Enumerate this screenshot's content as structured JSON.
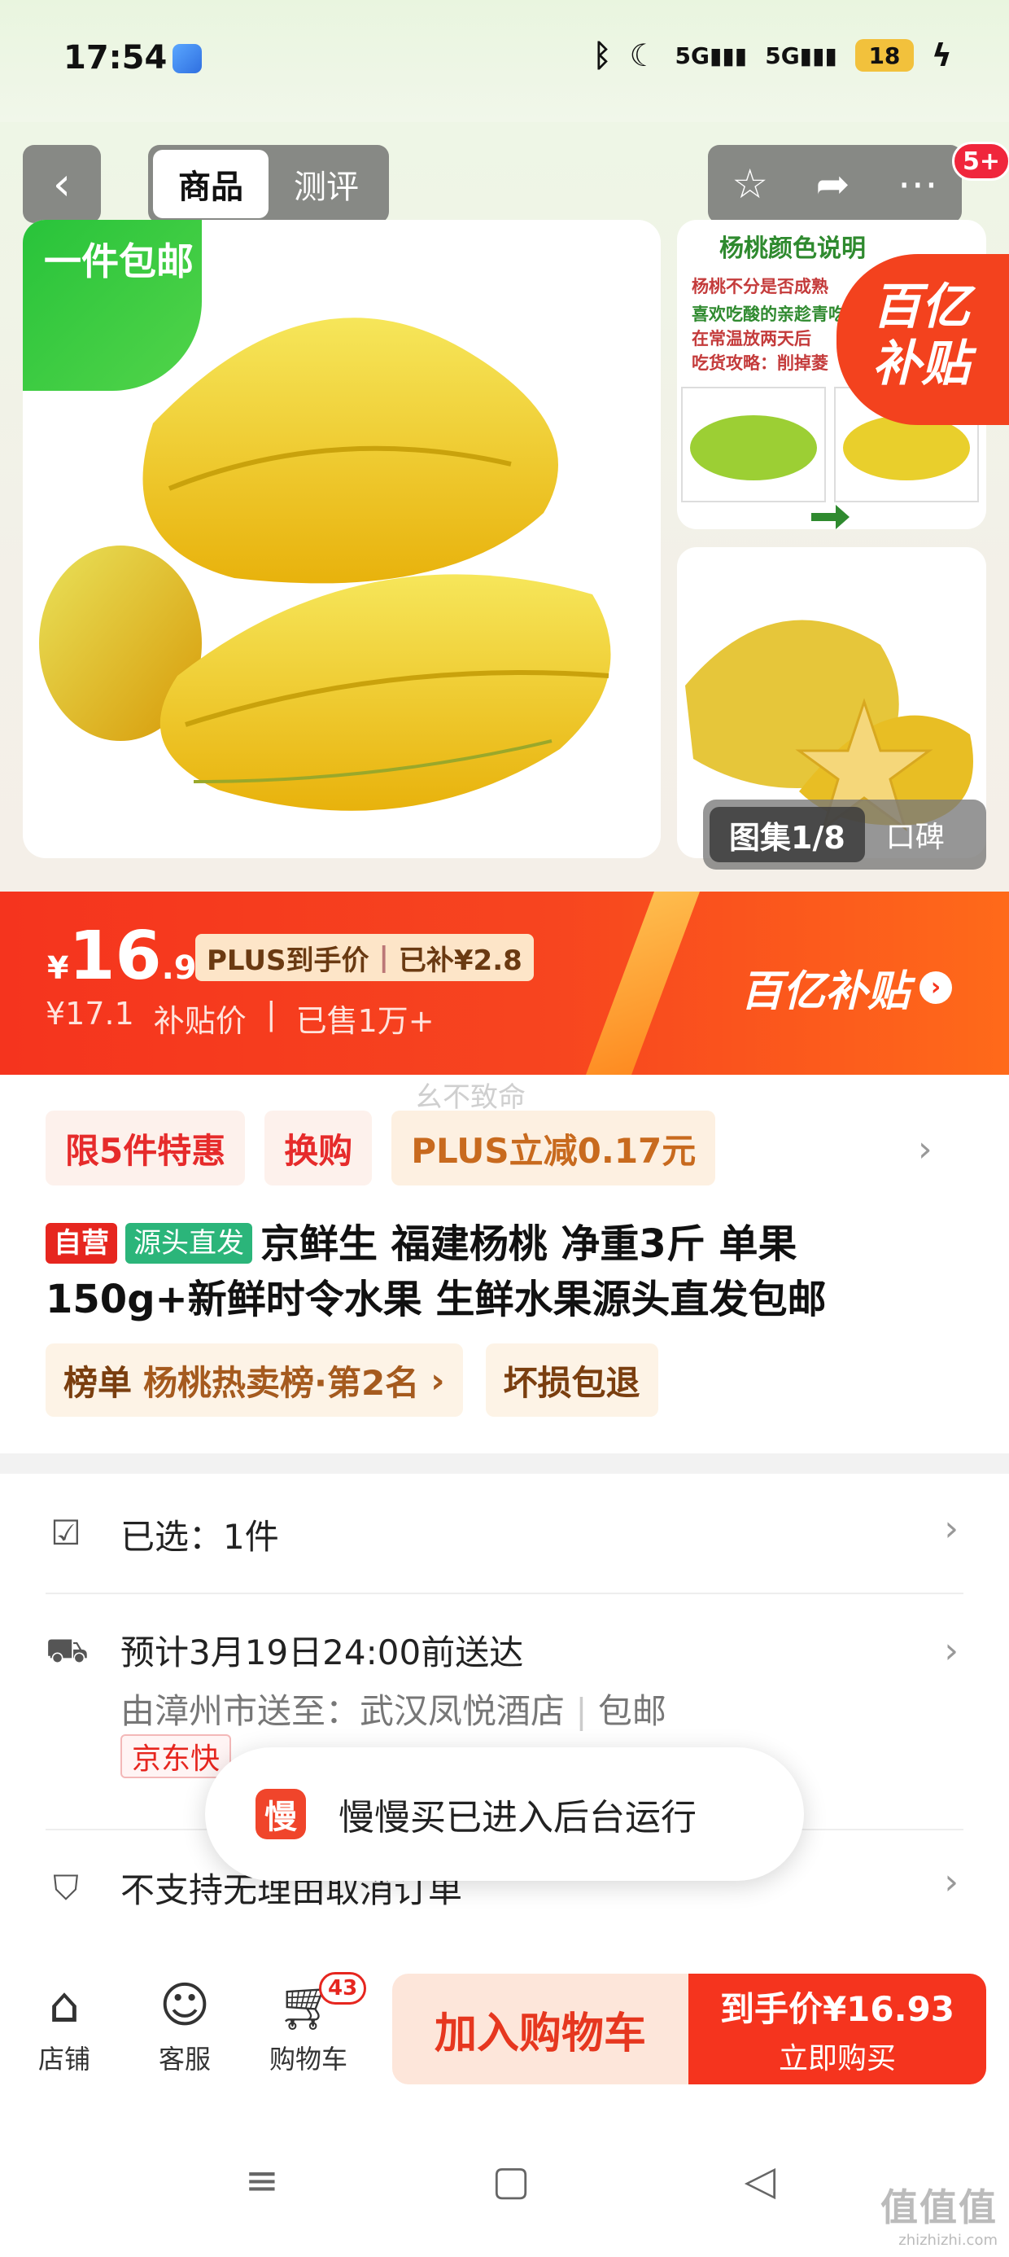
{
  "status_bar": {
    "time": "17:54",
    "battery": "18",
    "icons": [
      "bluetooth-icon",
      "moon-icon",
      "signal-5g-icon",
      "signal-5g-icon",
      "battery-icon",
      "charging-icon"
    ]
  },
  "nav": {
    "tabs": [
      {
        "label": "商品",
        "active": true
      },
      {
        "label": "测评",
        "active": false
      }
    ],
    "badge": "5+"
  },
  "gallery": {
    "free_shipping_badge": "一件包邮",
    "subsidy_badge": "百亿补贴",
    "thumb1_title": "杨桃颜色说明",
    "thumb1_lines": [
      "杨桃不分是否成熟",
      "喜欢吃酸的亲趁青吃",
      "在常温放两天后",
      "吃货攻略：削掉菱"
    ],
    "album_count": "图集1/8",
    "album_review": "口碑"
  },
  "price": {
    "currency": "¥",
    "integer": "16",
    "decimal": ".93",
    "plus_label": "PLUS到手价",
    "subsidy_label": "已补¥2.8",
    "original": "¥17.1",
    "subsidy_price_label": "补贴价",
    "sold": "已售1万+",
    "brand": "百亿补贴",
    "accent": "#f5341e"
  },
  "info": {
    "watermark": "幺不致命",
    "promos": [
      "限5件特惠",
      "换购",
      "PLUS立减0.17元"
    ],
    "tag_self": "自营",
    "tag_source": "源头直发",
    "title": "京鲜生 福建杨桃 净重3斤 单果150g+新鲜时令水果 生鲜水果源头直发包邮",
    "rank_label": "榜单",
    "rank_text": "杨桃热卖榜·第2名",
    "guarantee": "坏损包退"
  },
  "options": {
    "selected": "已选：1件",
    "delivery_eta": "预计3月19日24:00前送达",
    "delivery_route": "由漳州市送至：武汉凤悦酒店",
    "shipping": "包邮",
    "jd_fast": "京东快",
    "policy": "不支持无理由取消订单"
  },
  "toast": {
    "icon_text": "慢",
    "message": "慢慢买已进入后台运行"
  },
  "action_bar": {
    "store": "店铺",
    "service": "客服",
    "cart": "购物车",
    "cart_count": "43",
    "add_to_cart": "加入购物车",
    "buy_price": "到手价¥16.93",
    "buy_now": "立即购买"
  },
  "footer_mark": {
    "big": "值值值",
    "small": "zhizhizhi.com"
  }
}
